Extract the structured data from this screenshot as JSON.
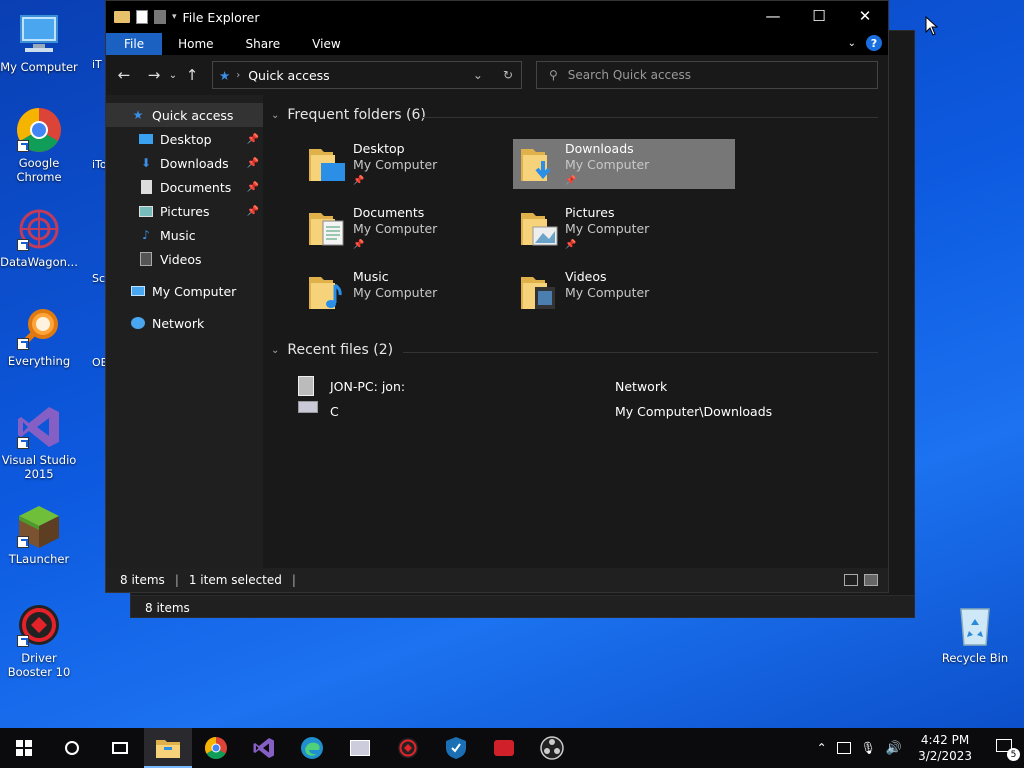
{
  "desktop": {
    "icons": [
      {
        "label": "My Computer"
      },
      {
        "label": "Google Chrome"
      },
      {
        "label": "DataWagon..."
      },
      {
        "label": "Everything"
      },
      {
        "label": "Visual Studio 2015"
      },
      {
        "label": "TLauncher"
      },
      {
        "label": "Driver Booster 10"
      },
      {
        "label": "Recycle Bin"
      }
    ],
    "partial_icons": [
      "iT",
      "iTo Re",
      "Scr",
      "OB"
    ]
  },
  "bg_window": {
    "status_items": "8 items"
  },
  "window": {
    "title": "File Explorer",
    "ribbon_tabs": [
      "File",
      "Home",
      "Share",
      "View"
    ],
    "address": "Quick access",
    "search_placeholder": "Search Quick access",
    "sidebar": [
      {
        "label": "Quick access"
      },
      {
        "label": "Desktop"
      },
      {
        "label": "Downloads"
      },
      {
        "label": "Documents"
      },
      {
        "label": "Pictures"
      },
      {
        "label": "Music"
      },
      {
        "label": "Videos"
      },
      {
        "label": "My Computer"
      },
      {
        "label": "Network"
      }
    ],
    "frequent_header": "Frequent folders (6)",
    "folders": [
      {
        "name": "Desktop",
        "location": "My Computer"
      },
      {
        "name": "Downloads",
        "location": "My Computer"
      },
      {
        "name": "Documents",
        "location": "My Computer"
      },
      {
        "name": "Pictures",
        "location": "My Computer"
      },
      {
        "name": "Music",
        "location": "My Computer"
      },
      {
        "name": "Videos",
        "location": "My Computer"
      }
    ],
    "recent_header": "Recent files (2)",
    "recent": [
      {
        "name": "JON-PC: jon:",
        "location": "Network"
      },
      {
        "name": "C",
        "location": "My Computer\\Downloads"
      }
    ],
    "status": {
      "items": "8 items",
      "selected": "1 item selected"
    }
  },
  "taskbar": {
    "time": "4:42 PM",
    "date": "3/2/2023",
    "notification_count": "5"
  },
  "colors": {
    "accent": "#1a61c2",
    "desktop": "#0d5ae0",
    "selected_tile": "#777777"
  }
}
